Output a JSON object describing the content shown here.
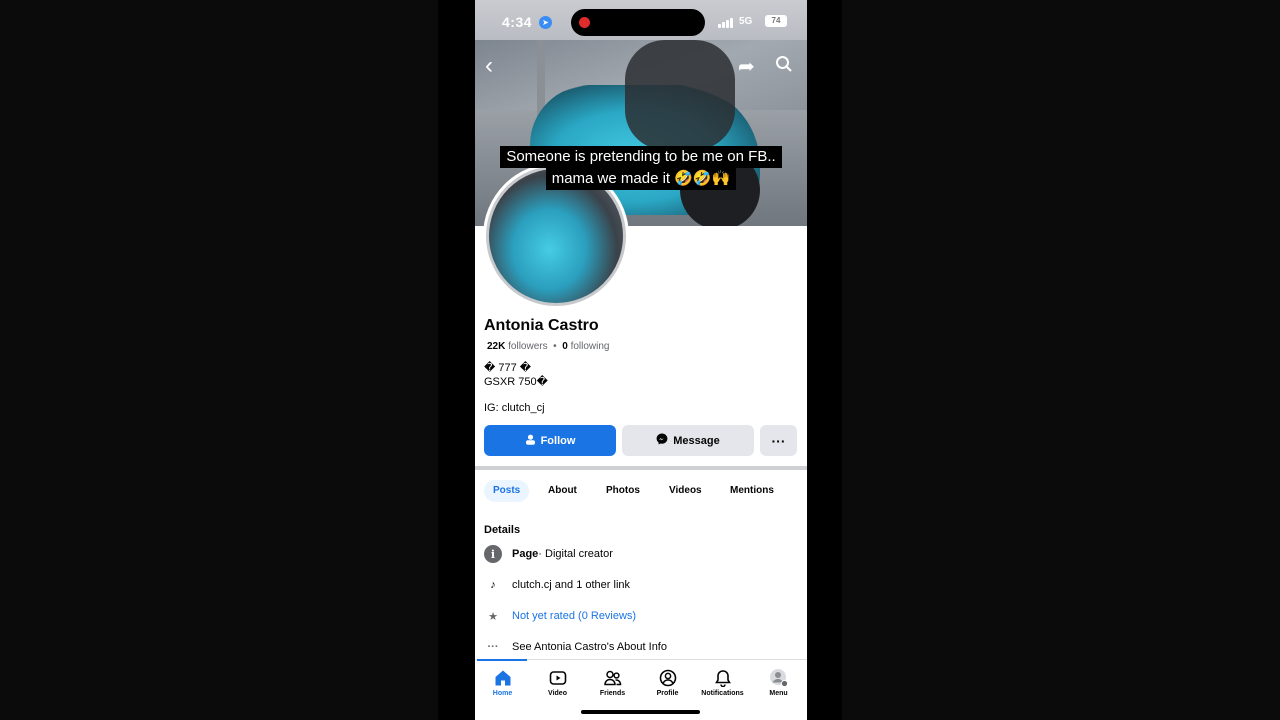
{
  "status_bar": {
    "time": "4:34",
    "network": "5G",
    "battery": "74"
  },
  "cover": {
    "caption_line1": "Someone is pretending to be me on FB..",
    "caption_line2": "mama we made it 🤣🤣🙌"
  },
  "profile": {
    "name": "Antonia Castro",
    "followers_count": "22K",
    "followers_label": "followers",
    "following_count": "0",
    "following_label": "following",
    "bio_line1": "� 777 �",
    "bio_line2": "GSXR 750�",
    "bio_line3": "IG: clutch_cj"
  },
  "actions": {
    "follow": "Follow",
    "message": "Message",
    "more": "···"
  },
  "tabs": [
    {
      "label": "Posts",
      "active": true
    },
    {
      "label": "About"
    },
    {
      "label": "Photos"
    },
    {
      "label": "Videos"
    },
    {
      "label": "Mentions"
    }
  ],
  "details": {
    "title": "Details",
    "page_bold": "Page",
    "page_rest": " · Digital creator",
    "links": "clutch.cj and 1 other link",
    "rating": "Not yet rated (0 Reviews)",
    "about": "See Antonia Castro's About Info"
  },
  "nav": [
    {
      "label": "Home",
      "icon": "home-icon",
      "active": true
    },
    {
      "label": "Video",
      "icon": "video-icon"
    },
    {
      "label": "Friends",
      "icon": "friends-icon"
    },
    {
      "label": "Profile",
      "icon": "profile-icon"
    },
    {
      "label": "Notifications",
      "icon": "bell-icon"
    },
    {
      "label": "Menu",
      "icon": "menu-avatar-icon"
    }
  ],
  "colors": {
    "accent": "#1b74e4",
    "button_gray": "#e4e6eb",
    "text": "#050505",
    "muted": "#65676b"
  }
}
